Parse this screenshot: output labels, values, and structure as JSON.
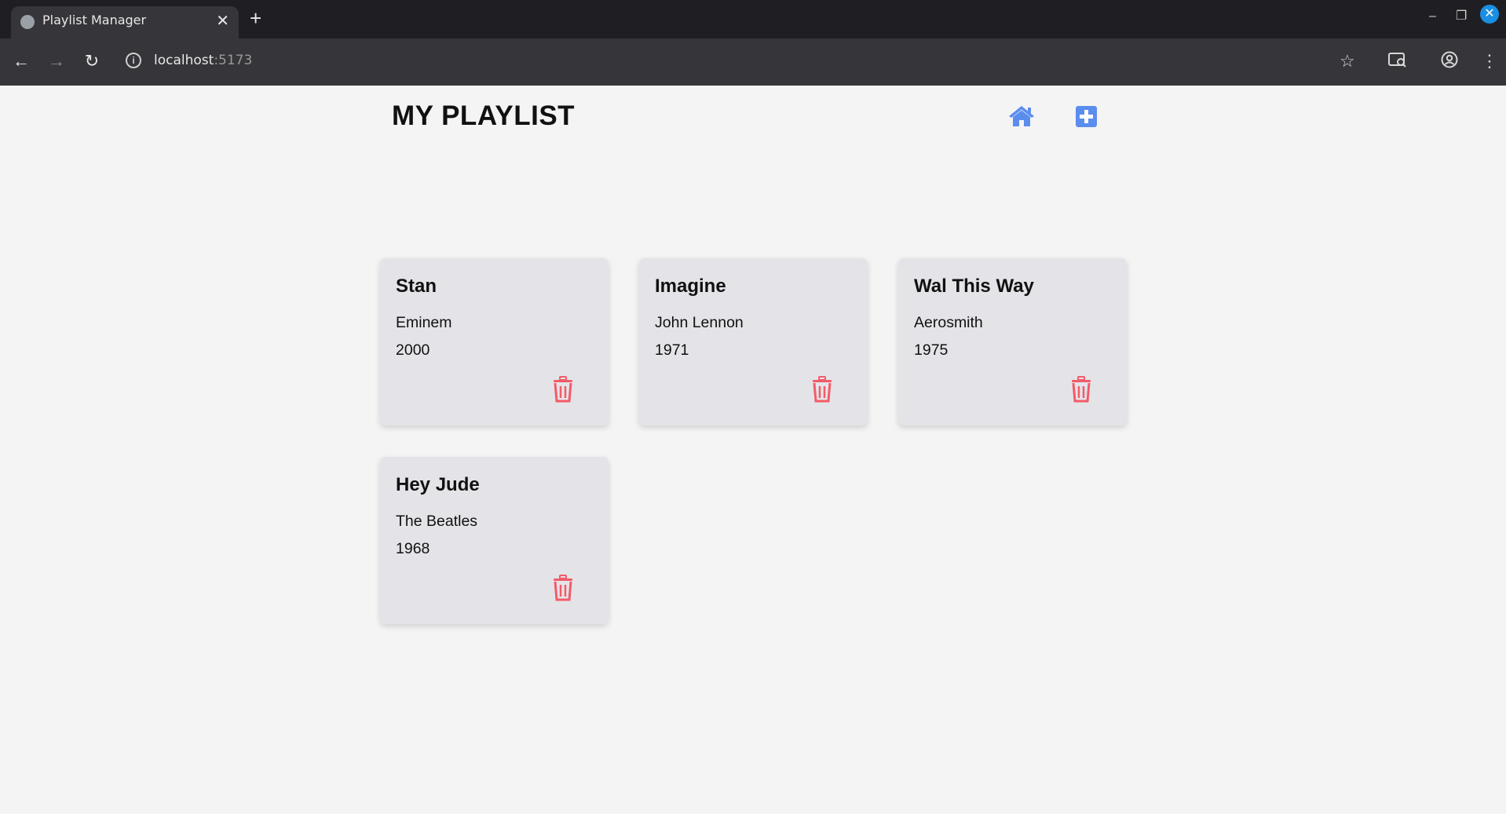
{
  "browser": {
    "tab_title": "Playlist Manager",
    "url_host": "localhost",
    "url_port": ":5173"
  },
  "app": {
    "title": "MY PLAYLIST",
    "accent_color": "#5b8def",
    "delete_color": "#f45b69"
  },
  "songs": [
    {
      "title": "Stan",
      "artist": "Eminem",
      "year": "2000"
    },
    {
      "title": "Imagine",
      "artist": "John Lennon",
      "year": "1971"
    },
    {
      "title": "Wal This Way",
      "artist": "Aerosmith",
      "year": "1975"
    },
    {
      "title": "Hey Jude",
      "artist": "The Beatles",
      "year": "1968"
    }
  ]
}
